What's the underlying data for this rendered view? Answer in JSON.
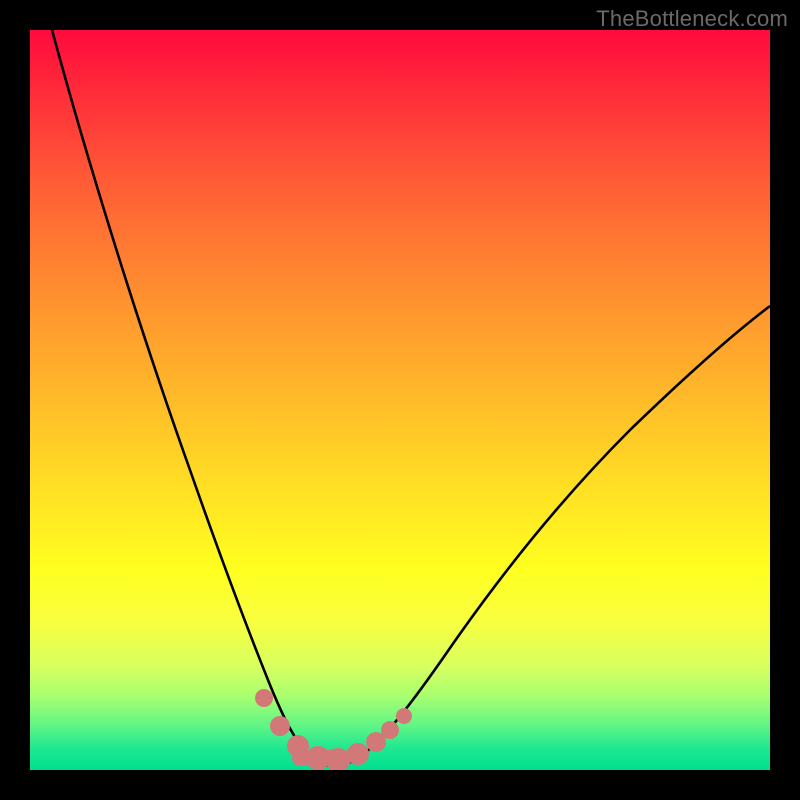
{
  "watermark": "TheBottleneck.com",
  "chart_data": {
    "type": "line",
    "title": "",
    "xlabel": "",
    "ylabel": "",
    "xlim": [
      0,
      100
    ],
    "ylim": [
      0,
      100
    ],
    "grid": false,
    "legend": false,
    "background_gradient": [
      "#ff0a3c",
      "#ffff20",
      "#00df8f"
    ],
    "series": [
      {
        "name": "bottleneck-curve",
        "color": "#000000",
        "x": [
          0,
          5,
          10,
          15,
          20,
          25,
          28,
          30,
          33,
          35,
          38,
          40,
          45,
          50,
          55,
          60,
          65,
          70,
          75,
          80,
          85,
          90,
          95,
          100
        ],
        "y": [
          100,
          84,
          69,
          55,
          42,
          30,
          21,
          14,
          8,
          4,
          2,
          1,
          2,
          5,
          10,
          16,
          22,
          28,
          34,
          40,
          45,
          50,
          54,
          58
        ]
      }
    ],
    "markers": {
      "name": "optimal-zone",
      "color": "#d77a7a",
      "points": [
        {
          "x": 30,
          "y": 9
        },
        {
          "x": 33,
          "y": 4
        },
        {
          "x": 36,
          "y": 2
        },
        {
          "x": 38,
          "y": 1
        },
        {
          "x": 40,
          "y": 1
        },
        {
          "x": 42,
          "y": 2
        },
        {
          "x": 45,
          "y": 4
        },
        {
          "x": 47,
          "y": 6
        },
        {
          "x": 49,
          "y": 8
        }
      ]
    }
  }
}
